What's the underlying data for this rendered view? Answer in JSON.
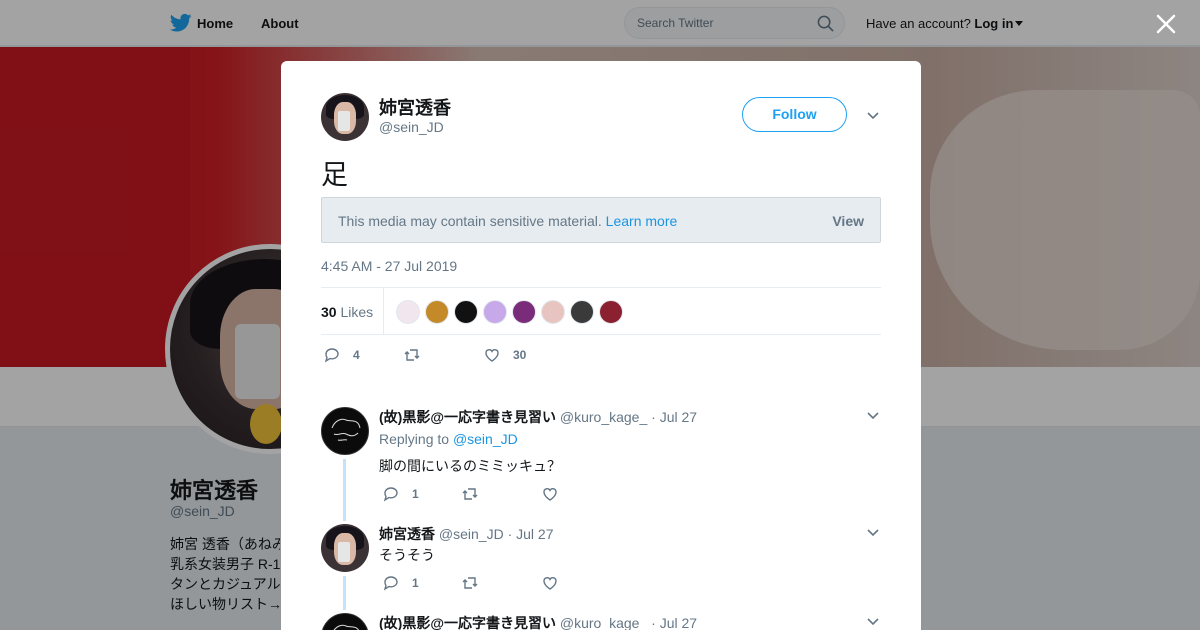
{
  "nav": {
    "home_label": "Home",
    "about_label": "About",
    "search_placeholder": "Search Twitter",
    "account_prompt": "Have an account?",
    "login_label": "Log in"
  },
  "profile": {
    "name": "姉宮透香",
    "handle": "@sein_JD",
    "bio_lines": [
      "姉宮 透香（あねみ",
      "乳系女装男子 R-1",
      "タンとカジュアル",
      "ほしい物リスト→"
    ]
  },
  "tweet": {
    "author_name": "姉宮透香",
    "author_handle": "@sein_JD",
    "follow_label": "Follow",
    "text": "足",
    "sensitive_text": "This media may contain sensitive material.",
    "sensitive_link": "Learn more",
    "view_label": "View",
    "timestamp": "4:45 AM - 27 Jul 2019",
    "likes_count": "30",
    "likes_label": "Likes",
    "replies": "4",
    "retweets": "",
    "likes": "30",
    "liker_colors": [
      "#f2e6ee",
      "#c48a2a",
      "#111111",
      "#c7a8e8",
      "#7a2b7a",
      "#e8c4c0",
      "#3a3a3a",
      "#8a2030"
    ]
  },
  "replies": [
    {
      "name": "(故)黒影@一応字書き見習い",
      "handle": "@kuro_kage_",
      "date": "Jul 27",
      "replying_prefix": "Replying to",
      "replying_to": "@sein_JD",
      "text": "脚の間にいるのミミッキュ？",
      "reply_count": "1",
      "retweet_count": "",
      "like_count": ""
    },
    {
      "name": "姉宮透香",
      "handle": "@sein_JD",
      "date": "Jul 27",
      "text": "そうそう",
      "reply_count": "1",
      "retweet_count": "",
      "like_count": ""
    },
    {
      "name": "(故)黒影@一応字書き見習い",
      "handle": "@kuro_kage_",
      "date": "Jul 27"
    }
  ],
  "colors": {
    "twitter_blue": "#1da1f2",
    "link_blue": "#1b95e0",
    "secondary_text": "#657786",
    "thread_line": "#c4e3f8"
  },
  "icons": {
    "nav_logo": "twitter-bird-icon",
    "search": "search-icon",
    "close": "close-icon",
    "reply": "reply-icon",
    "retweet": "retweet-icon",
    "like": "heart-icon",
    "more": "chevron-down-icon"
  }
}
